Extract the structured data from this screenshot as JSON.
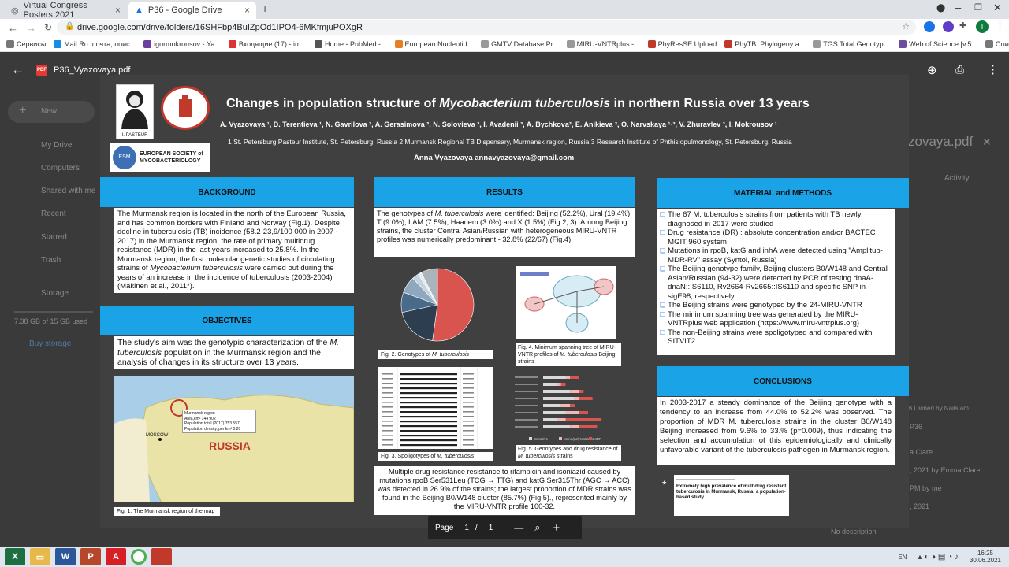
{
  "browser": {
    "tabs": [
      {
        "title": "Virtual Congress Posters 2021"
      },
      {
        "title": "P36 - Google Drive"
      }
    ],
    "new_tab": "+",
    "url": "drive.google.com/drive/folders/16SHFbp4BuIZpOd1IPO4-6MKfmjuPOXgR",
    "bookmarks": [
      "Сервисы",
      "Mail.Ru: почта, поис...",
      "igormokrousov - Ya...",
      "Входящие (17) - im...",
      "Home - PubMed -...",
      "European Nucleotid...",
      "GMTV Database Pr...",
      "MIRU-VNTRplus -...",
      "PhyResSE Upload",
      "PhyTB: Phylogeny a...",
      "TGS Total Genotypi...",
      "Web of Science [v.5...",
      "Список для чтения"
    ]
  },
  "viewer": {
    "file_name": "P36_Vyazovaya.pdf",
    "pdf_badge": "PDF"
  },
  "drive_bg": {
    "new_label": "New",
    "nav": [
      "My Drive",
      "Computers",
      "Shared with me",
      "Recent",
      "Starred",
      "Trash",
      "Storage"
    ],
    "storage_text": "7.38 GB of 15 GB used",
    "buy_storage": "Buy storage",
    "right_title": "zovaya.pdf",
    "right_activity": "Activity",
    "right_lines": [
      "B Owned by Nails.am",
      "P36",
      "a Clare",
      ", 2021 by Emma Clare",
      "PM by me",
      ", 2021",
      "No description"
    ]
  },
  "poster": {
    "title_pre": "Changes in population structure of ",
    "title_italic": "Mycobacterium tuberculosis",
    "title_post": " in northern Russia over 13 years",
    "authors": "A. Vyazovaya ¹, D. Terentieva ¹, N. Gavrilova ², A. Gerasimova ², N. Solovieva ³, I. Avadenii ³, A. Bychkova², E. Anikieva ², O. Narvskaya ¹·³, V. Zhuravlev ³, I. Mokrousov ¹",
    "affiliations": "1 St. Petersburg Pasteur Institute, St. Petersburg, Russia   2 Murmansk Regional TB Dispensary, Murmansk region, Russia   3 Research Institute of Phthisiopulmonology, St. Petersburg, Russia",
    "contact": "Anna Vyazovaya annavyazovaya@gmail.com",
    "logo_pasteur": "I. PASTEUR",
    "logo_esm_line1": "EUROPEAN SOCIETY of",
    "logo_esm_line2": "MYCOBACTERIOLOGY",
    "logo_esm_badge": "ESM",
    "background_header": "BACKGROUND",
    "background_text_1": "The Murmansk region is located in the north of the European Russia, and has common borders with Finland and Norway (Fig.1). Despite  decline in tuberculosis (TB) incidence (58.2-23,9/100 000 in 2007 - 2017) in the Murmansk region, the rate of primary multidrug resistance (MDR) in the last years increased to 25.8%. In the Murmansk region, the first molecular genetic studies of circulating strains of ",
    "background_text_italic": "Mycobacterium tuberculosis",
    "background_text_2": " were carried out during the years of an increase in the incidence of tuberculosis (2003-2004) (Makinen et al., 2011*).",
    "objectives_header": "OBJECTIVES",
    "objectives_text_1": "The study's aim was the genotypic characterization of the ",
    "objectives_text_italic": "M. tuberculosis",
    "objectives_text_2": " population in the Murmansk region and the analysis of changes in its structure over 13 years.",
    "map_label_russia": "RUSSIA",
    "map_label_moscow": "MOSCOW",
    "map_inset_1": "Murmansk region",
    "map_inset_2": "Area,km² 144 902",
    "map_inset_3": "Population total (2017) 753 557",
    "map_inset_4": "Population density, per km² 5.20",
    "fig1_caption": "Fig. 1. The Murmansk region of the map",
    "results_header": "RESULTS",
    "results_text_1": "The genotypes of ",
    "results_text_italic": "M. tuberculosis",
    "results_text_2": " were identified: Beijing (52.2%), Ural (19.4%), T (9.0%), LAM (7.5%), Haarlem (3.0%) and X (1.5%) (Fig.2, 3). Among Beijing strains, the cluster Central Asian/Russian with heterogeneous MIRU-VNTR profiles was numerically predominant - 32.8% (22/67) (Fig.4).",
    "fig2_caption": "Fig. 2. Genotypes of ",
    "fig2_caption_italic": "M. tuberculosis",
    "fig3_caption": "Fig. 3. Spoligotypes of ",
    "fig3_caption_italic": "M. tuberculosis",
    "fig4_caption_1": "Fig. 4. Minimum spanning tree of MIRU-VNTR profiles of ",
    "fig4_caption_italic": "M. tuberculosis",
    "fig4_caption_2": " Beijing strains",
    "fig5_caption_1": "Fig. 5. Genotypes and drug resistance of ",
    "fig5_caption_italic": "M. tuberculosis",
    "fig5_caption_2": " strains",
    "mdr_text": "Multiple drug resistance  resistance to rifampicin and isoniazid caused by mutations rpoB Ser531Leu (TCG → TTG) and katG Ser315Thr (AGC → ACC) was detected in 26.9% of the strains; the largest proportion of MDR strains was found in the Beijing B0/W148 cluster (85.7%) (Fig.5)., represented mainly by the MIRU-VNTR profile 100-32.",
    "methods_header": "MATERIAL and METHODS",
    "methods_items": [
      "The 67 M. tuberculosis strains from patients with TB newly diagnosed in 2017 were studied",
      "Drug resistance (DR) : absolute concentration and/or BACTEC MGIT 960 system",
      "Mutations in rpoB, katG and inhA were detected using \"Amplitub-MDR-RV\" assay (Syntol, Russia)",
      "The Beijing genotype family, Beijing clusters B0/W148 and Central Asian/Russian (94-32) were detected by PCR of testing dnaA-dnaN::IS6110, Rv2664-Rv2665::IS6110 and specific SNP in sigE98, respectively",
      "The Beijing strains were  genotyped by the 24-MIRU-VNTR",
      "The minimum spanning tree was generated by the MIRU-VNTRplus web application (https://www.miru-vntrplus.org)",
      "The non-Beijing strains were spoligotyped and compared with SITVIT2"
    ],
    "conclusions_header": "CONCLUSIONS",
    "conclusions_text": "In 2003-2017 a steady dominance of the Beijing genotype with a tendency to an increase from 44.0% to 52.2% was observed. The proportion of MDR M. tuberculosis strains in the cluster B0/W148 Beijing increased from 9.6% to 33.% (p=0.009), thus indicating the selection and accumulation of this epidemiologically and clinically unfavorable variant of the tuberculosis pathogen in Murmansk region.",
    "asterisk": "*",
    "ref_title": "Extremely high prevalence of multidrug resistant tuberculosis in Murmansk, Russia: a population-based study",
    "pie_slices": [
      {
        "value": 52.2,
        "color": "#d9534f"
      },
      {
        "value": 19.4,
        "color": "#2d3e50"
      },
      {
        "value": 9.0,
        "color": "#4a6a8a"
      },
      {
        "value": 7.5,
        "color": "#8fa8c0"
      },
      {
        "value": 3.0,
        "color": "#c5d3df"
      },
      {
        "value": 1.5,
        "color": "#e6ecf1"
      },
      {
        "value": 7.4,
        "color": "#aab4bd"
      }
    ],
    "fig5_legend": [
      "Sensitive",
      "Mono/polyresistant",
      "MDR"
    ],
    "fig5_bars": [
      {
        "s": 0.5,
        "m": 0.1,
        "r": 0.2
      },
      {
        "s": 0.3,
        "m": 0.1,
        "r": 0.1
      },
      {
        "s": 0.6,
        "m": 0.2,
        "r": 0.1
      },
      {
        "s": 0.7,
        "m": 0.1,
        "r": 0.3
      },
      {
        "s": 0.4,
        "m": 0.2,
        "r": 0.1
      },
      {
        "s": 0.5,
        "m": 0.3,
        "r": 0.2
      },
      {
        "s": 0.3,
        "m": 0.2,
        "r": 0.8
      },
      {
        "s": 0.6,
        "m": 0.2,
        "r": 0.4
      }
    ]
  },
  "pagebar": {
    "page_label": "Page",
    "current": "1",
    "sep": "/",
    "total": "1",
    "minus": "—",
    "plus": "+"
  },
  "taskbar": {
    "lang": "EN",
    "time": "16:25",
    "date": "30.06.2021"
  }
}
